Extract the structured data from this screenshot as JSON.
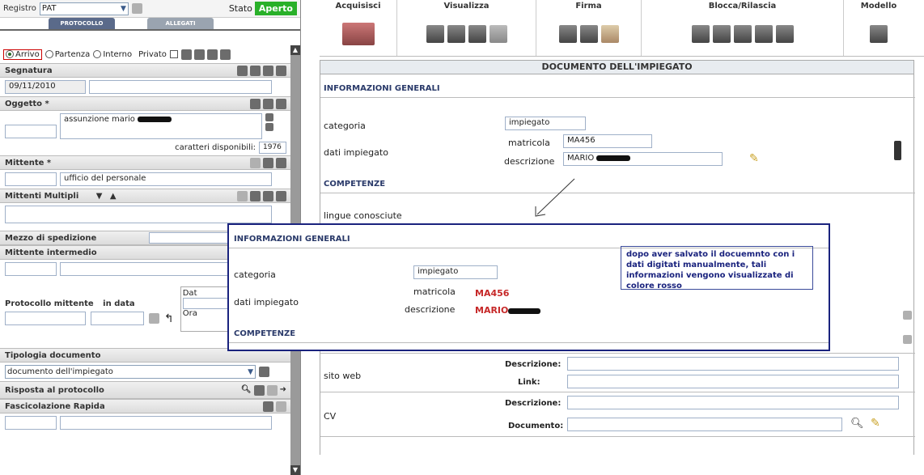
{
  "left": {
    "registro_label": "Registro",
    "registro_value": "PAT",
    "stato_label": "Stato",
    "stato_value": "Aperto",
    "tabs": [
      "PROTOCOLLO",
      "ALLEGATI"
    ],
    "radios": [
      "Arrivo",
      "Partenza",
      "Interno"
    ],
    "privato_label": "Privato",
    "segnatura_label": "Segnatura",
    "segnatura_date": "09/11/2010",
    "oggetto_label": "Oggetto *",
    "oggetto_text": "assunzione mario",
    "caratteri_label": "caratteri disponibili:",
    "caratteri_value": "1976",
    "mittente_label": "Mittente *",
    "mittente_value": "ufficio del personale",
    "mittenti_multipli_label": "Mittenti Multipli",
    "mezzo_label": "Mezzo di spedizione",
    "mittente_intermedio_label": "Mittente intermedio",
    "protocollo_mittente_label": "Protocollo mittente",
    "in_data_label": "in data",
    "dat_label": "Dat",
    "ora_label": "Ora",
    "tipologia_label": "Tipologia documento",
    "tipologia_value": "documento dell'impiegato",
    "risposta_label": "Risposta al protocollo",
    "fascicolazione_label": "Fascicolazione Rapida"
  },
  "toolbar": {
    "groups": [
      "Acquisisci",
      "Visualizza",
      "Firma",
      "Blocca/Rilascia",
      "Modello"
    ]
  },
  "doc": {
    "title": "DOCUMENTO DELL'IMPIEGATO",
    "info_generali": "INFORMAZIONI GENERALI",
    "categoria_label": "categoria",
    "categoria_value": "impiegato",
    "dati_label": "dati impiegato",
    "matricola_label": "matricola",
    "matricola_value": "MA456",
    "descrizione_label": "descrizione",
    "descrizione_value": "MARIO",
    "competenze": "COMPETENZE",
    "lingue_label": "lingue conosciute",
    "sito_label": "sito web",
    "descrizione2_label": "Descrizione:",
    "link_label": "Link:",
    "cv_label": "CV",
    "descrizione3_label": "Descrizione:",
    "documento_label": "Documento:"
  },
  "overlay": {
    "info_generali": "INFORMAZIONI GENERALI",
    "categoria_label": "categoria",
    "categoria_value": "impiegato",
    "dati_label": "dati impiegato",
    "matricola_label": "matricola",
    "matricola_value": "MA456",
    "descrizione_label": "descrizione",
    "descrizione_value": "MARIO",
    "competenze": "COMPETENZE",
    "note": "dopo aver salvato il docuemnto con i dati digitati manualmente, tali informazioni vengono visualizzate di colore rosso"
  }
}
